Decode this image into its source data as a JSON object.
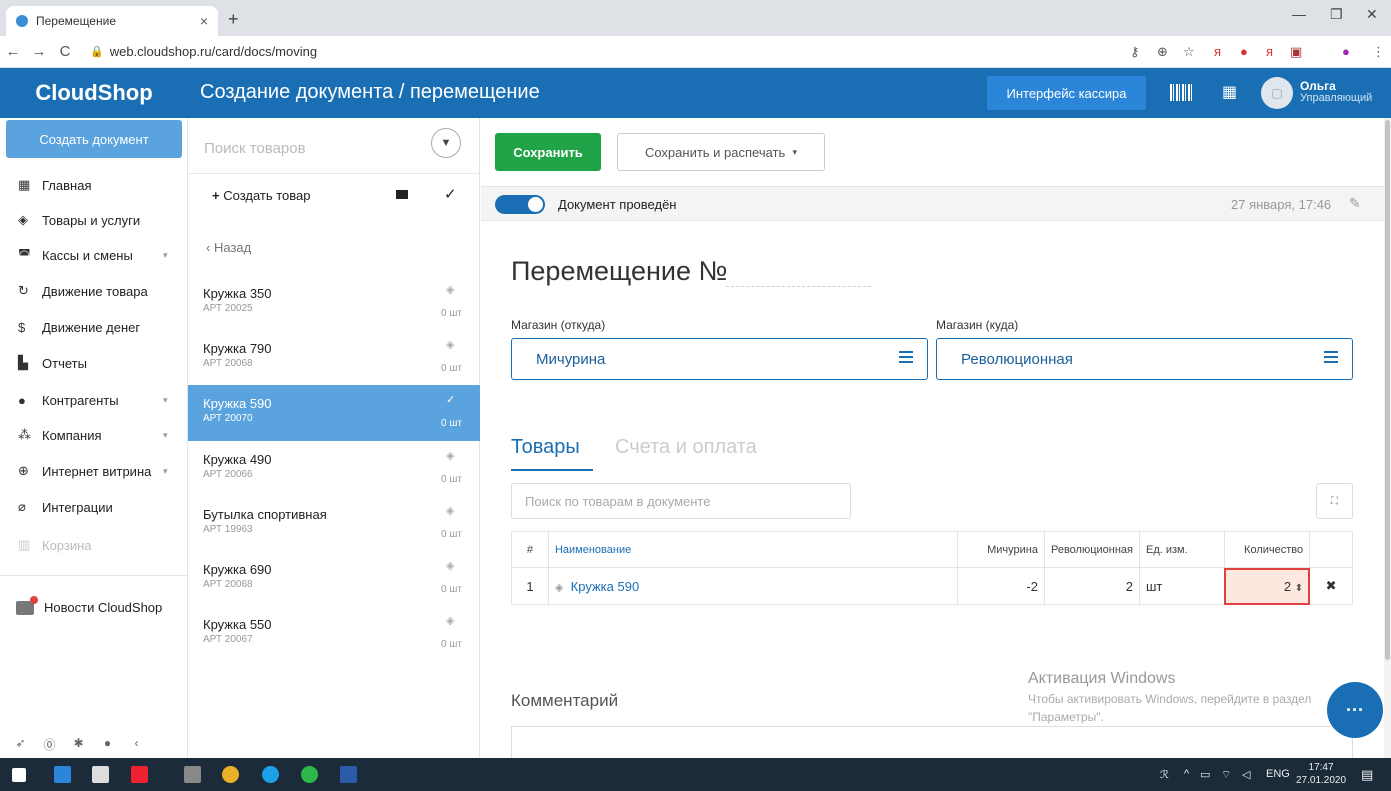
{
  "browser": {
    "tab_title": "Перемещение",
    "tab_close": "×",
    "new_tab": "+",
    "url": "web.cloudshop.ru/card/docs/moving"
  },
  "header": {
    "brand": "CloudShop",
    "title": "Создание документа / перемещение",
    "cashier_button": "Интерфейс кассира",
    "user_name": "Ольга",
    "user_role": "Управляющий"
  },
  "sidebar": {
    "create_button": "Создать документ",
    "items": [
      {
        "label": "Главная",
        "icon": "grid-icon"
      },
      {
        "label": "Товары и услуги",
        "icon": "box-icon"
      },
      {
        "label": "Кассы и смены",
        "icon": "cash-icon"
      },
      {
        "label": "Движение товара",
        "icon": "refresh-icon"
      },
      {
        "label": "Движение денег",
        "icon": "dollar-icon"
      },
      {
        "label": "Отчеты",
        "icon": "chart-icon"
      },
      {
        "label": "Контрагенты",
        "icon": "person-icon"
      },
      {
        "label": "Компания",
        "icon": "people-icon"
      },
      {
        "label": "Интернет витрина",
        "icon": "globe-icon"
      },
      {
        "label": "Интеграции",
        "icon": "clip-icon"
      },
      {
        "label": "Корзина",
        "icon": "trash-icon"
      }
    ],
    "news": "Новости CloudShop"
  },
  "products": {
    "search_placeholder": "Поиск товаров",
    "create_label": "Создать товар",
    "back_label": "Назад",
    "items": [
      {
        "name": "Кружка 350",
        "article": "АРТ 20025",
        "qty": "0 шт"
      },
      {
        "name": "Кружка 790",
        "article": "АРТ 20068",
        "qty": "0 шт"
      },
      {
        "name": "Кружка 590",
        "article": "АРТ 20070",
        "qty": "0 шт"
      },
      {
        "name": "Кружка 490",
        "article": "АРТ 20066",
        "qty": "0 шт"
      },
      {
        "name": "Бутылка спортивная",
        "article": "АРТ 19963",
        "qty": "0 шт"
      },
      {
        "name": "Кружка 690",
        "article": "АРТ 20068",
        "qty": "0 шт"
      },
      {
        "name": "Кружка 550",
        "article": "АРТ 20067",
        "qty": "0 шт"
      }
    ]
  },
  "doc": {
    "save_button": "Сохранить",
    "save_print_button": "Сохранить и распечать",
    "status_text": "Документ проведён",
    "date": "27 января, 17:46",
    "title": "Перемещение №",
    "from_label": "Магазин (откуда)",
    "from_value": "Мичурина",
    "to_label": "Магазин (куда)",
    "to_value": "Революционная",
    "tab_goods": "Товары",
    "tab_payments": "Счета и оплата",
    "search_placeholder": "Поиск по товарам в документе",
    "table": {
      "headers": [
        "#",
        "Наименование",
        "Мичурина",
        "Революционная",
        "Ед. изм.",
        "Количество"
      ],
      "rows": [
        {
          "num": "1",
          "name": "Кружка 590",
          "from": "-2",
          "to": "2",
          "unit": "шт",
          "qty": "2"
        }
      ]
    },
    "comment_label": "Комментарий"
  },
  "watermark": {
    "title": "Активация Windows",
    "line1": "Чтобы активировать Windows, перейдите в раздел",
    "line2": "\"Параметры\"."
  },
  "taskbar": {
    "lang": "ENG",
    "time": "17:47",
    "date": "27.01.2020"
  },
  "colors": {
    "brand": "#1a6fb4",
    "selected": "#5ba3de",
    "save": "#20a447"
  }
}
